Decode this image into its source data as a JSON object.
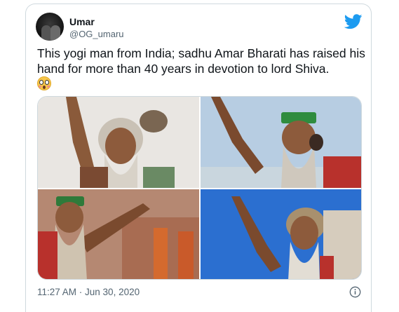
{
  "tweet": {
    "display_name": "Umar",
    "handle": "@OG_umaru",
    "text": "This yogi man from India; sadhu Amar Bharati has raised his hand for more than 40 years in devotion to lord Shiva.",
    "timestamp": "11:27 AM · Jun 30, 2020"
  },
  "icons": {
    "brand": "twitter-bird-icon",
    "emoji": "flushed-face-emoji",
    "info": "info-icon"
  },
  "colors": {
    "brand_blue": "#1d9bf0",
    "text": "#0f1419",
    "secondary": "#536471",
    "border": "#cfd9de"
  },
  "media": {
    "photo_count": 4
  }
}
